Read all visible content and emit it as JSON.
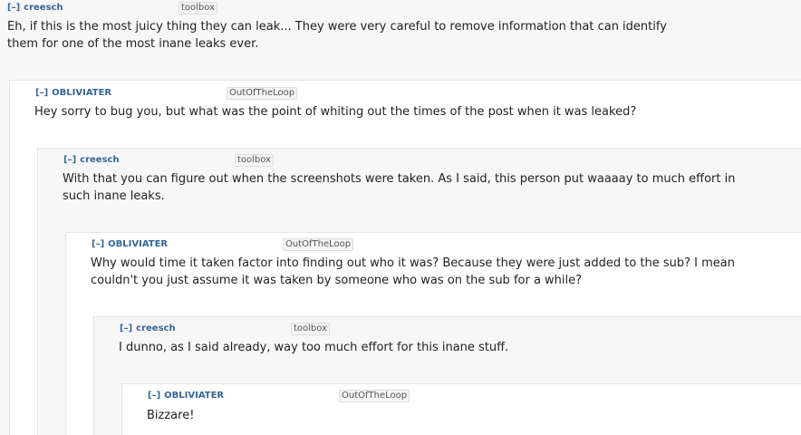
{
  "comments": [
    {
      "toggle": "[–]",
      "author": "creesch",
      "flair": "toolbox",
      "body": "Eh, if this is the most juicy thing they can leak... They were very careful to remove information that can identify\nthem for one of the most inane leaks ever."
    },
    {
      "toggle": "[–]",
      "author": "OBLIVIATER",
      "flair": "OutOfTheLoop",
      "body": "Hey sorry to bug you, but what was the point of whiting out the times of the post when it was leaked?"
    },
    {
      "toggle": "[–]",
      "author": "creesch",
      "flair": "toolbox",
      "body": "With that you can figure out when the screenshots were taken. As I said, this person put waaaay to much effort in\nsuch inane leaks."
    },
    {
      "toggle": "[–]",
      "author": "OBLIVIATER",
      "flair": "OutOfTheLoop",
      "body": "Why would time it taken factor into finding out who it was? Because they were just added to the sub? I mean\ncouldn't you just assume it was taken by someone who was on the sub for a while?"
    },
    {
      "toggle": "[–]",
      "author": "creesch",
      "flair": "toolbox",
      "body": "I dunno, as I said already, way too much effort for this inane stuff."
    },
    {
      "toggle": "[–]",
      "author": "OBLIVIATER",
      "flair": "OutOfTheLoop",
      "body": "Bizzare!"
    }
  ]
}
